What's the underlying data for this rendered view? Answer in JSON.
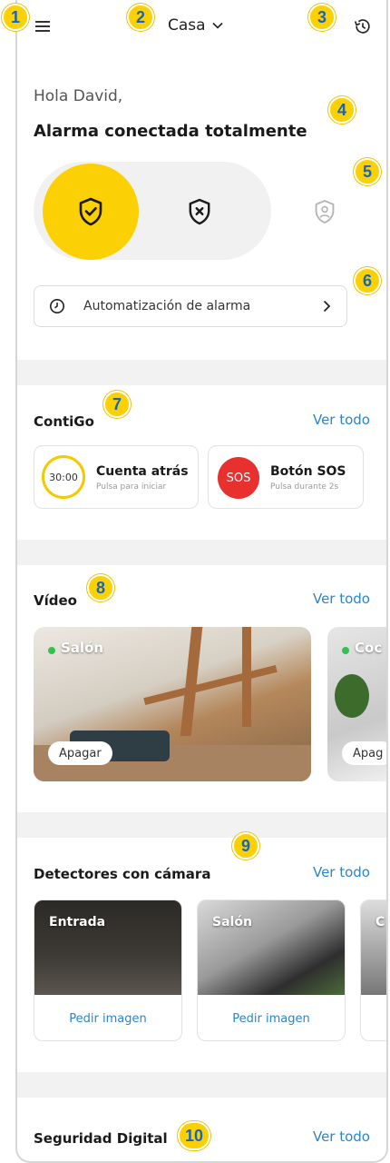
{
  "header": {
    "location_label": "Casa"
  },
  "alarm": {
    "greeting": "Hola David,",
    "status": "Alarma conectada totalmente",
    "modes": [
      {
        "name": "armed",
        "active": true
      },
      {
        "name": "disarmed",
        "active": false
      },
      {
        "name": "partial",
        "active": false
      }
    ],
    "automation_label": "Automatización de alarma"
  },
  "contigo": {
    "title": "ContiGo",
    "see_all": "Ver todo",
    "countdown": {
      "timer": "30:00",
      "title": "Cuenta atrás",
      "subtitle": "Pulsa para iniciar"
    },
    "sos": {
      "badge": "SOS",
      "title": "Botón SOS",
      "subtitle": "Pulsa durante 2s"
    }
  },
  "video": {
    "title": "Vídeo",
    "see_all": "Ver todo",
    "cameras": [
      {
        "label": "Salón",
        "action": "Apagar"
      },
      {
        "label": "Coc",
        "action": "Apag"
      }
    ]
  },
  "detectors": {
    "title": "Detectores con cámara",
    "see_all": "Ver todo",
    "items": [
      {
        "label": "Entrada",
        "action": "Pedir imagen"
      },
      {
        "label": "Salón",
        "action": "Pedir imagen"
      },
      {
        "label": "C",
        "action": ""
      }
    ]
  },
  "digital": {
    "title": "Seguridad Digital",
    "see_all": "Ver todo"
  },
  "annotations": [
    "1",
    "2",
    "3",
    "4",
    "5",
    "6",
    "7",
    "8",
    "9",
    "10"
  ],
  "colors": {
    "accent": "#fbd105",
    "link": "#2a86c9",
    "sos": "#e8302f",
    "live": "#33c24d"
  }
}
